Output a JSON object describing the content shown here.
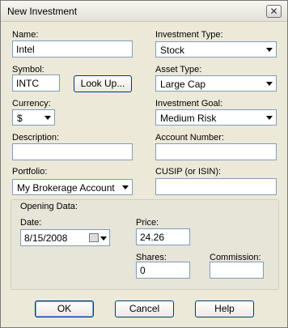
{
  "window": {
    "title": "New Investment",
    "close_glyph": "✕"
  },
  "fields": {
    "name": {
      "label": "Name:",
      "value": "Intel"
    },
    "symbol": {
      "label": "Symbol:",
      "value": "INTC"
    },
    "lookup_button": "Look Up...",
    "currency": {
      "label": "Currency:",
      "value": "$"
    },
    "description": {
      "label": "Description:",
      "value": ""
    },
    "portfolio": {
      "label": "Portfolio:",
      "value": "My Brokerage Account"
    },
    "investment_type": {
      "label": "Investment Type:",
      "value": "Stock"
    },
    "asset_type": {
      "label": "Asset Type:",
      "value": "Large Cap"
    },
    "investment_goal": {
      "label": "Investment Goal:",
      "value": "Medium Risk"
    },
    "account_number": {
      "label": "Account Number:",
      "value": ""
    },
    "cusip": {
      "label": "CUSIP (or ISIN):",
      "value": ""
    }
  },
  "opening": {
    "group_label": "Opening Data:",
    "date": {
      "label": "Date:",
      "value": "8/15/2008"
    },
    "price": {
      "label": "Price:",
      "value": "24.26"
    },
    "shares": {
      "label": "Shares:",
      "value": "0"
    },
    "commission": {
      "label": "Commission:",
      "value": ""
    }
  },
  "buttons": {
    "ok": "OK",
    "cancel": "Cancel",
    "help": "Help"
  }
}
